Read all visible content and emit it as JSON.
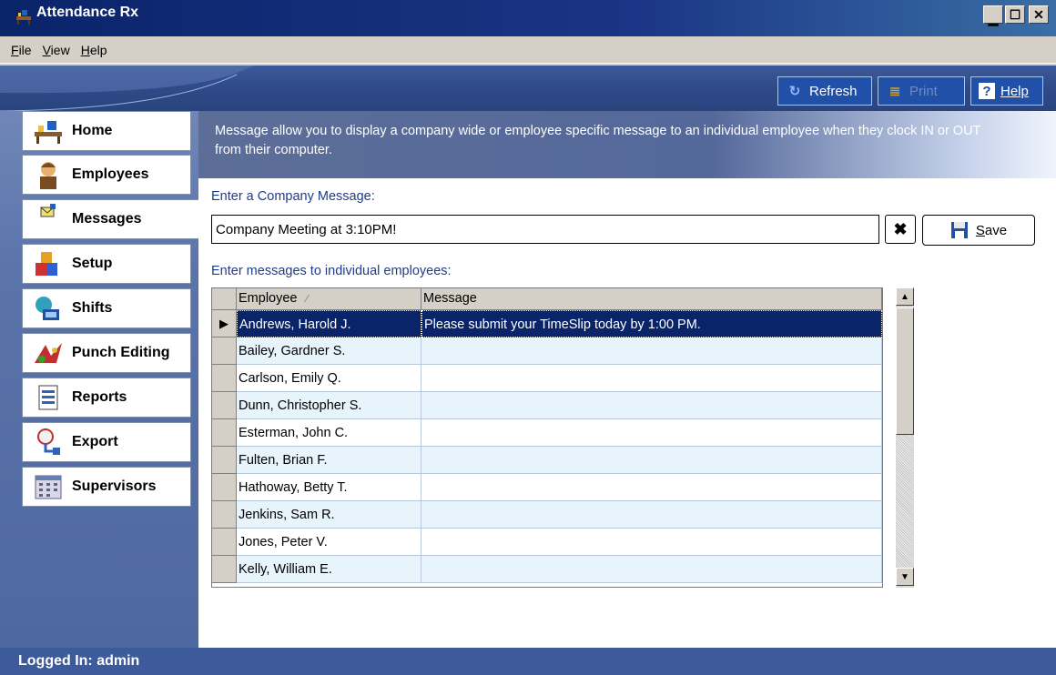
{
  "window": {
    "title": "Attendance Rx"
  },
  "menu": [
    {
      "label": "File",
      "key": "F"
    },
    {
      "label": "View",
      "key": "V"
    },
    {
      "label": "Help",
      "key": "H"
    }
  ],
  "toolbar": {
    "refresh_label": "Refresh",
    "print_label": "Print",
    "help_label": "Help"
  },
  "sidebar": {
    "items": [
      {
        "label": "Home",
        "icon": "home-desk-icon"
      },
      {
        "label": "Employees",
        "icon": "employee-person-icon"
      },
      {
        "label": "Messages",
        "icon": "messages-icon",
        "active": true
      },
      {
        "label": "Setup",
        "icon": "setup-blocks-icon"
      },
      {
        "label": "Shifts",
        "icon": "shifts-icon"
      },
      {
        "label": "Punch Editing",
        "icon": "punch-editing-icon"
      },
      {
        "label": "Reports",
        "icon": "reports-icon"
      },
      {
        "label": "Export",
        "icon": "export-icon"
      },
      {
        "label": "Supervisors",
        "icon": "supervisors-calendar-icon"
      }
    ]
  },
  "description": "Message allow you to display a company wide or employee specific message to an individual employee when they clock IN or OUT from their computer.",
  "company_message": {
    "label": "Enter a Company Message:",
    "value": "Company Meeting at 3:10PM!",
    "clear_label": "✖",
    "save_label": "Save"
  },
  "individual": {
    "label": "Enter messages to individual employees:",
    "columns": [
      "Employee",
      "Message"
    ],
    "sort_indicator": "∕",
    "rows": [
      {
        "employee": "Andrews, Harold J.",
        "message": "Please submit your TimeSlip today by 1:00 PM.",
        "selected": true
      },
      {
        "employee": "Bailey, Gardner S.",
        "message": ""
      },
      {
        "employee": "Carlson, Emily Q.",
        "message": ""
      },
      {
        "employee": "Dunn, Christopher S.",
        "message": ""
      },
      {
        "employee": "Esterman, John C.",
        "message": ""
      },
      {
        "employee": "Fulten, Brian F.",
        "message": ""
      },
      {
        "employee": "Hathoway, Betty T.",
        "message": ""
      },
      {
        "employee": "Jenkins, Sam R.",
        "message": ""
      },
      {
        "employee": "Jones, Peter V.",
        "message": ""
      },
      {
        "employee": "Kelly, William E.",
        "message": ""
      }
    ]
  },
  "status": {
    "text": "Logged In: admin"
  },
  "colors": {
    "title_bar": "#0a246a",
    "selected_row": "#0a246a",
    "alt_row": "#e8f4fc",
    "label_blue": "#1f3c8c"
  }
}
